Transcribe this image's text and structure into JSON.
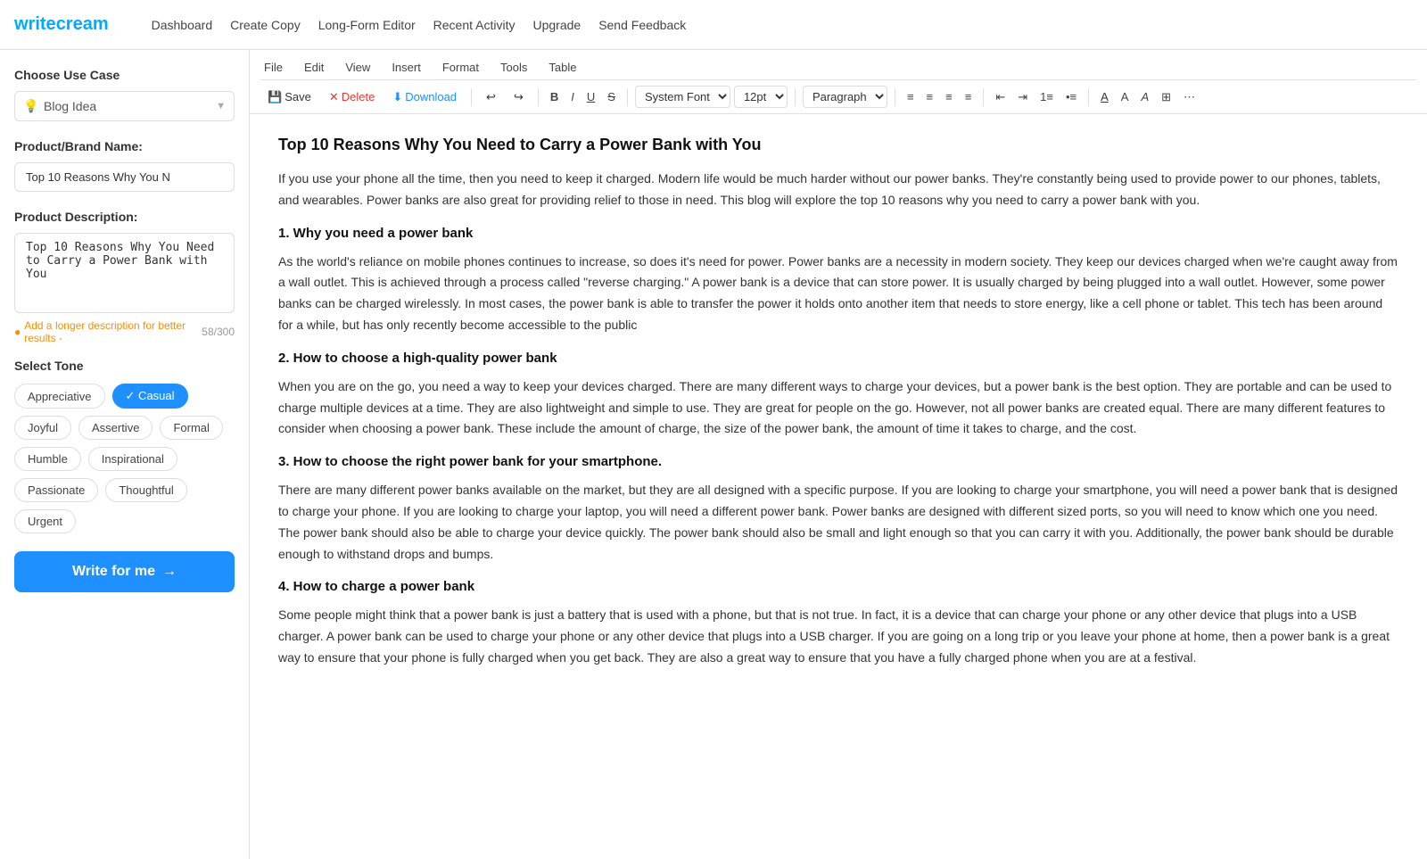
{
  "logo": {
    "write": "write",
    "cream": "cream"
  },
  "nav": {
    "items": [
      {
        "id": "dashboard",
        "label": "Dashboard"
      },
      {
        "id": "create-copy",
        "label": "Create Copy"
      },
      {
        "id": "long-form-editor",
        "label": "Long-Form Editor"
      },
      {
        "id": "recent-activity",
        "label": "Recent Activity"
      },
      {
        "id": "upgrade",
        "label": "Upgrade"
      },
      {
        "id": "send-feedback",
        "label": "Send Feedback"
      }
    ]
  },
  "sidebar": {
    "use_case_title": "Choose Use Case",
    "use_case_value": "Blog Idea",
    "product_name_title": "Product/Brand Name:",
    "product_name_value": "Top 10 Reasons Why You N",
    "product_desc_title": "Product Description:",
    "product_desc_value": "Top 10 Reasons Why You Need to Carry a Power Bank with You",
    "add_description_hint": "Add a longer description for better results -",
    "char_count": "58/300",
    "select_tone_title": "Select Tone",
    "tones": [
      {
        "id": "appreciative",
        "label": "Appreciative",
        "active": false
      },
      {
        "id": "casual",
        "label": "Casual",
        "active": true
      },
      {
        "id": "joyful",
        "label": "Joyful",
        "active": false
      },
      {
        "id": "assertive",
        "label": "Assertive",
        "active": false
      },
      {
        "id": "formal",
        "label": "Formal",
        "active": false
      },
      {
        "id": "humble",
        "label": "Humble",
        "active": false
      },
      {
        "id": "inspirational",
        "label": "Inspirational",
        "active": false
      },
      {
        "id": "passionate",
        "label": "Passionate",
        "active": false
      },
      {
        "id": "thoughtful",
        "label": "Thoughtful",
        "active": false
      },
      {
        "id": "urgent",
        "label": "Urgent",
        "active": false
      }
    ],
    "write_btn_label": "Write for me"
  },
  "menu": {
    "items": [
      "File",
      "Edit",
      "View",
      "Insert",
      "Format",
      "Tools",
      "Table"
    ]
  },
  "toolbar": {
    "save_label": "Save",
    "delete_label": "Delete",
    "download_label": "Download",
    "font_family": "System Font",
    "font_size": "12pt",
    "paragraph": "Paragraph"
  },
  "editor": {
    "title": "Top 10 Reasons Why You Need to Carry a Power Bank with You",
    "sections": [
      {
        "type": "paragraph",
        "text": "If you use your phone all the time, then you need to keep it charged. Modern life would be much harder without our power banks. They're constantly being used to provide power to our phones, tablets, and wearables. Power banks are also great for providing relief to those in need. This blog will explore the top 10 reasons why you need to carry a power bank with you."
      },
      {
        "type": "heading",
        "text": "1. Why you need a power bank"
      },
      {
        "type": "paragraph",
        "text": "As the world's reliance on mobile phones continues to increase, so does it's need for power. Power banks are a necessity in modern society. They keep our devices charged when we're caught away from a wall outlet. This is achieved through a process called \"reverse charging.\" A power bank is a device that can store power. It is usually charged by being plugged into a wall outlet. However, some power banks can be charged wirelessly. In most cases, the power bank is able to transfer the power it holds onto another item that needs to store energy, like a cell phone or tablet. This tech has been around for a while, but has only recently become accessible to the public"
      },
      {
        "type": "heading",
        "text": "2. How to choose a high-quality power bank"
      },
      {
        "type": "paragraph",
        "text": "When you are on the go, you need a way to keep your devices charged. There are many different ways to charge your devices, but a power bank is the best option. They are portable and can be used to charge multiple devices at a time. They are also lightweight and simple to use. They are great for people on the go. However, not all power banks are created equal. There are many different features to consider when choosing a power bank. These include the amount of charge, the size of the power bank, the amount of time it takes to charge, and the cost."
      },
      {
        "type": "heading",
        "text": "3. How to choose the right power bank for your smartphone."
      },
      {
        "type": "paragraph",
        "text": "There are many different power banks available on the market, but they are all designed with a specific purpose. If you are looking to charge your smartphone, you will need a power bank that is designed to charge your phone. If you are looking to charge your laptop, you will need a different power bank. Power banks are designed with different sized ports, so you will need to know which one you need. The power bank should also be able to charge your device quickly. The power bank should also be small and light enough so that you can carry it with you. Additionally, the power bank should be durable enough to withstand drops and bumps."
      },
      {
        "type": "heading",
        "text": "4. How to charge a power bank"
      },
      {
        "type": "paragraph",
        "text": "Some people might think that a power bank is just a battery that is used with a phone, but that is not true. In fact, it is a device that can charge your phone or any other device that plugs into a USB charger. A power bank can be used to charge your phone or any other device that plugs into a USB charger. If you are going on a long trip or you leave your phone at home, then a power bank is a great way to ensure that your phone is fully charged when you get back. They are also a great way to ensure that you have a fully charged phone when you are at a festival."
      }
    ]
  }
}
